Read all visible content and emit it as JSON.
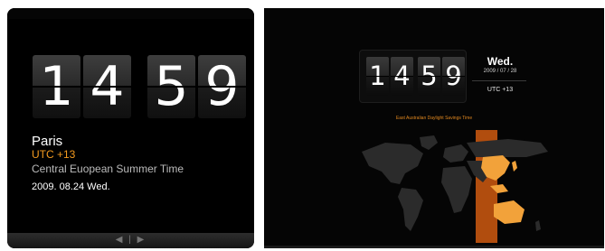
{
  "left_widget": {
    "time": {
      "hour_tens": "1",
      "hour_ones": "4",
      "minute_tens": "5",
      "minute_ones": "9"
    },
    "city": "Paris",
    "utc_offset": "UTC +13",
    "timezone_name": "Central Euopean Summer Time",
    "date": "2009. 08.24  Wed.",
    "nav_arrows": "◀ | ▶",
    "accent_color": "#f39a1f"
  },
  "right_widget": {
    "time": {
      "hour_tens": "1",
      "hour_ones": "4",
      "minute_tens": "5",
      "minute_ones": "9"
    },
    "weekday": "Wed.",
    "date": "2009 / 07 / 28",
    "utc_offset": "UTC +13",
    "timezone_name": "East Australian Daylight Savings Time",
    "city_list": "",
    "highlight_color": "#e0871f",
    "map_icon": "world-map-icon"
  }
}
